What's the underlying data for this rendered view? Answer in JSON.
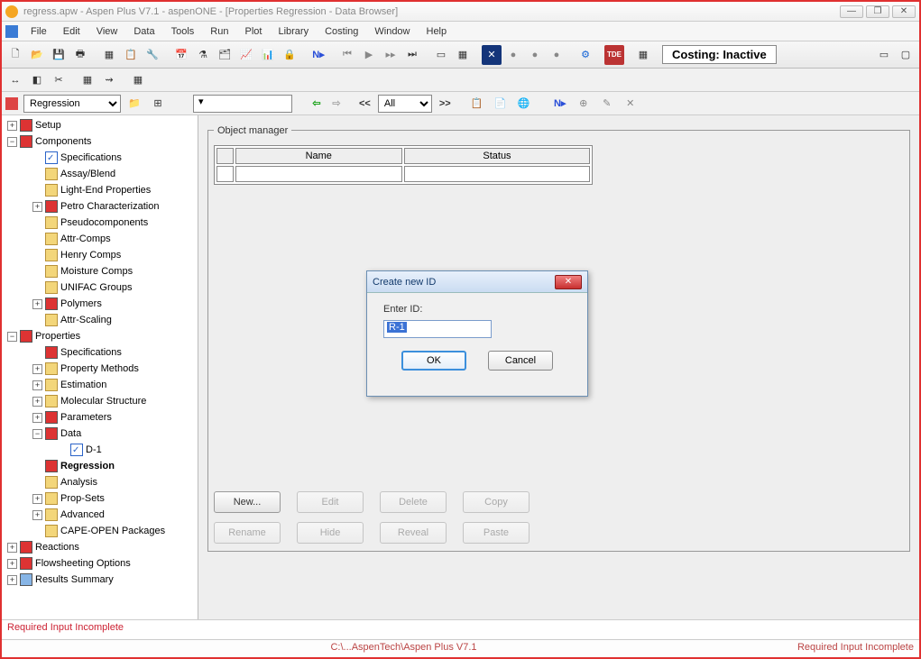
{
  "window": {
    "title": "regress.apw - Aspen Plus V7.1 - aspenONE - [Properties Regression - Data Browser]"
  },
  "menu": [
    "File",
    "Edit",
    "View",
    "Data",
    "Tools",
    "Run",
    "Plot",
    "Library",
    "Costing",
    "Window",
    "Help"
  ],
  "costing_label": "Costing: Inactive",
  "nav": {
    "tree_combo": "Regression",
    "filter_combo": "All"
  },
  "tree": {
    "setup": "Setup",
    "components": "Components",
    "c_spec": "Specifications",
    "c_assay": "Assay/Blend",
    "c_light": "Light-End Properties",
    "c_petro": "Petro Characterization",
    "c_pseudo": "Pseudocomponents",
    "c_attr": "Attr-Comps",
    "c_henry": "Henry Comps",
    "c_moist": "Moisture Comps",
    "c_unifac": "UNIFAC Groups",
    "c_poly": "Polymers",
    "c_attrscale": "Attr-Scaling",
    "properties": "Properties",
    "p_spec": "Specifications",
    "p_methods": "Property Methods",
    "p_est": "Estimation",
    "p_mol": "Molecular Structure",
    "p_param": "Parameters",
    "p_data": "Data",
    "p_d1": "D-1",
    "p_reg": "Regression",
    "p_analysis": "Analysis",
    "p_props": "Prop-Sets",
    "p_adv": "Advanced",
    "p_cape": "CAPE-OPEN Packages",
    "reactions": "Reactions",
    "flow": "Flowsheeting Options",
    "results": "Results Summary"
  },
  "content": {
    "object_manager": "Object manager",
    "col_name": "Name",
    "col_status": "Status",
    "btn_new": "New...",
    "btn_edit": "Edit",
    "btn_delete": "Delete",
    "btn_copy": "Copy",
    "btn_rename": "Rename",
    "btn_hide": "Hide",
    "btn_reveal": "Reveal",
    "btn_paste": "Paste"
  },
  "dialog": {
    "title": "Create new ID",
    "label": "Enter ID:",
    "value": "R-1",
    "ok": "OK",
    "cancel": "Cancel"
  },
  "status": {
    "msg": "Required Input Incomplete",
    "path": "C:\\...AspenTech\\Aspen Plus V7.1",
    "right": "Required Input Incomplete"
  }
}
